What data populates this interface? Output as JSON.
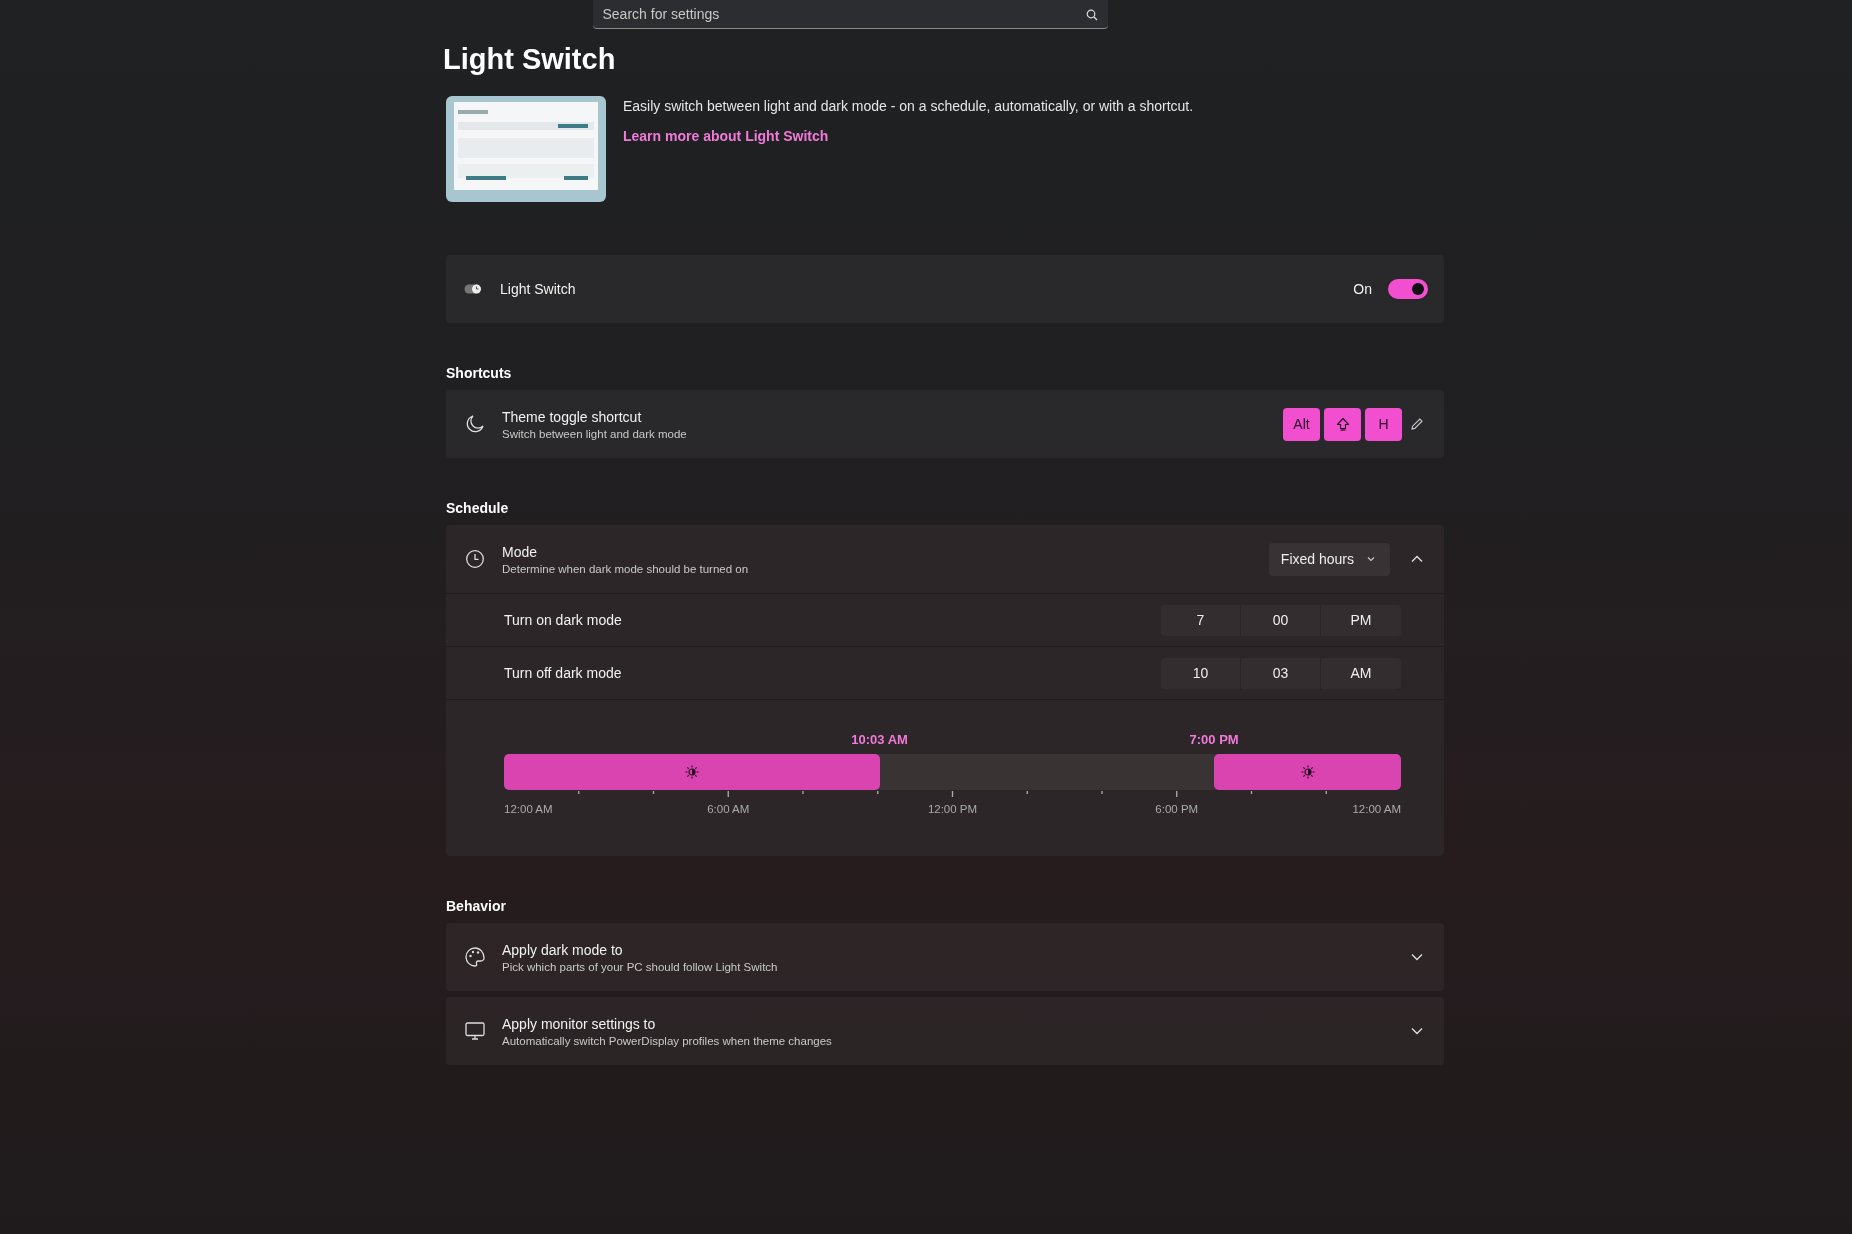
{
  "search": {
    "placeholder": "Search for settings"
  },
  "page_title": "Light Switch",
  "header": {
    "description": "Easily switch between light and dark mode - on a schedule, automatically, or with a shortcut.",
    "link": "Learn more about Light Switch"
  },
  "enable_card": {
    "title": "Light Switch",
    "state_label": "On",
    "on": true
  },
  "sections": [
    {
      "title": "Shortcuts",
      "kind": "shortcut",
      "card": {
        "title": "Theme toggle shortcut",
        "subtitle": "Switch between light and dark mode",
        "keys": [
          {
            "kind": "text",
            "label": "Alt"
          },
          {
            "kind": "shift"
          },
          {
            "kind": "text",
            "label": "H"
          }
        ]
      }
    },
    {
      "title": "Schedule",
      "kind": "schedule",
      "card": {
        "title": "Mode",
        "subtitle": "Determine when dark mode should be turned on",
        "dropdown": "Fixed hours",
        "expanded": true,
        "times": [
          {
            "label": "Turn on dark mode",
            "hour": "7",
            "minute": "00",
            "period": "PM",
            "pm": true
          },
          {
            "label": "Turn off dark mode",
            "hour": "10",
            "minute": "03",
            "period": "AM",
            "pm": false
          }
        ],
        "timeline": {
          "markers": [
            "10:03 AM",
            "7:00 PM"
          ],
          "axis_labels": [
            "12:00 AM",
            "6:00 AM",
            "12:00 PM",
            "6:00 PM",
            "12:00 AM"
          ]
        }
      }
    },
    {
      "title": "Behavior",
      "kind": "behavior",
      "cards": [
        {
          "kind": "palette",
          "title": "Apply dark mode to",
          "subtitle": "Pick which parts of your PC should follow Light Switch",
          "expanded": false
        },
        {
          "kind": "monitor",
          "title": "Apply monitor settings to",
          "subtitle": "Automatically switch PowerDisplay profiles when theme changes",
          "expanded": false
        }
      ]
    }
  ]
}
